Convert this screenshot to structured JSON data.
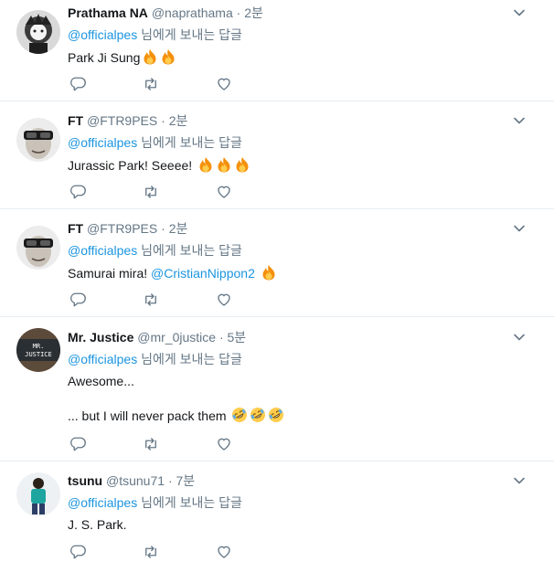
{
  "tweets": [
    {
      "name": "Prathama NA",
      "handle": "@naprathama",
      "time": "2분",
      "reply_to": "@officialpes",
      "reply_suffix": "님에게 보내는 답글",
      "text": "Park Ji Sung",
      "emoji": [
        "fire-emoji",
        "fire-emoji"
      ]
    },
    {
      "name": "FT",
      "handle": "@FTR9PES",
      "time": "2분",
      "reply_to": "@officialpes",
      "reply_suffix": "님에게 보내는 답글",
      "text": "Jurassic Park! Seeee!",
      "emoji": [
        "fire-emoji",
        "fire-emoji",
        "fire-emoji"
      ]
    },
    {
      "name": "FT",
      "handle": "@FTR9PES",
      "time": "2분",
      "reply_to": "@officialpes",
      "reply_suffix": "님에게 보내는 답글",
      "text": "Samurai mira!",
      "text_mention": "@CristianNippon2",
      "emoji": [
        "fire-emoji"
      ]
    },
    {
      "name": "Mr. Justice",
      "handle": "@mr_0justice",
      "time": "5분",
      "reply_to": "@officialpes",
      "reply_suffix": "님에게 보내는 답글",
      "text": "Awesome...",
      "text2": "... but I will never pack them",
      "avatar_text": "MR. JUSTICE",
      "emoji": [
        "rofl-emoji",
        "rofl-emoji",
        "rofl-emoji"
      ]
    },
    {
      "name": "tsunu",
      "handle": "@tsunu71",
      "time": "7분",
      "reply_to": "@officialpes",
      "reply_suffix": "님에게 보내는 답글",
      "text": "J. S. Park."
    }
  ],
  "meta": {
    "dot": "·"
  },
  "icons": {
    "reply": "reply-icon",
    "retweet": "retweet-icon",
    "like": "heart-icon",
    "more": "chevron-down-icon"
  },
  "colors": {
    "link": "#1b95e0",
    "muted": "#657786",
    "border": "#e6ecf0"
  }
}
